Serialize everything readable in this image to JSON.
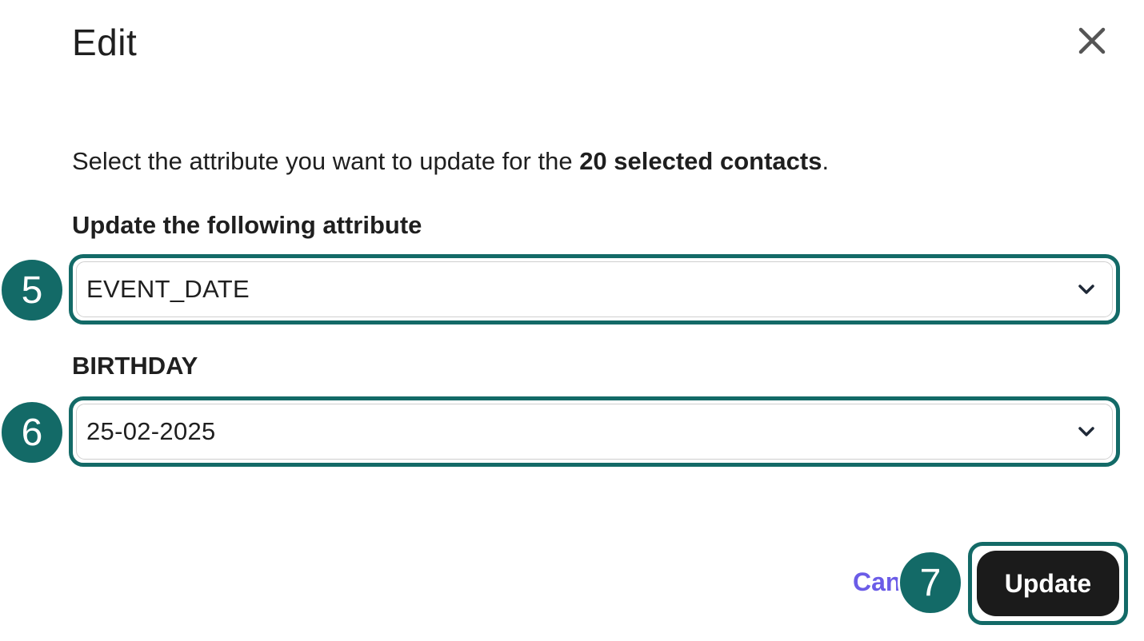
{
  "dialog": {
    "title": "Edit",
    "close_icon": "close-icon"
  },
  "description": {
    "prefix": "Select the attribute you want to update for the ",
    "bold": "20 selected contacts",
    "suffix": "."
  },
  "attribute_field": {
    "label": "Update the following attribute",
    "value": "EVENT_DATE",
    "step": "5",
    "icon": "chevron-down-icon"
  },
  "birthday_field": {
    "label": "BIRTHDAY",
    "value": "25-02-2025",
    "step": "6",
    "icon": "chevron-down-icon"
  },
  "actions": {
    "cancel_label": "Can",
    "update_label": "Update",
    "step": "7"
  },
  "colors": {
    "highlight": "#136a67",
    "cancel_link": "#6b5ce7",
    "update_button": "#1b1b1b"
  }
}
